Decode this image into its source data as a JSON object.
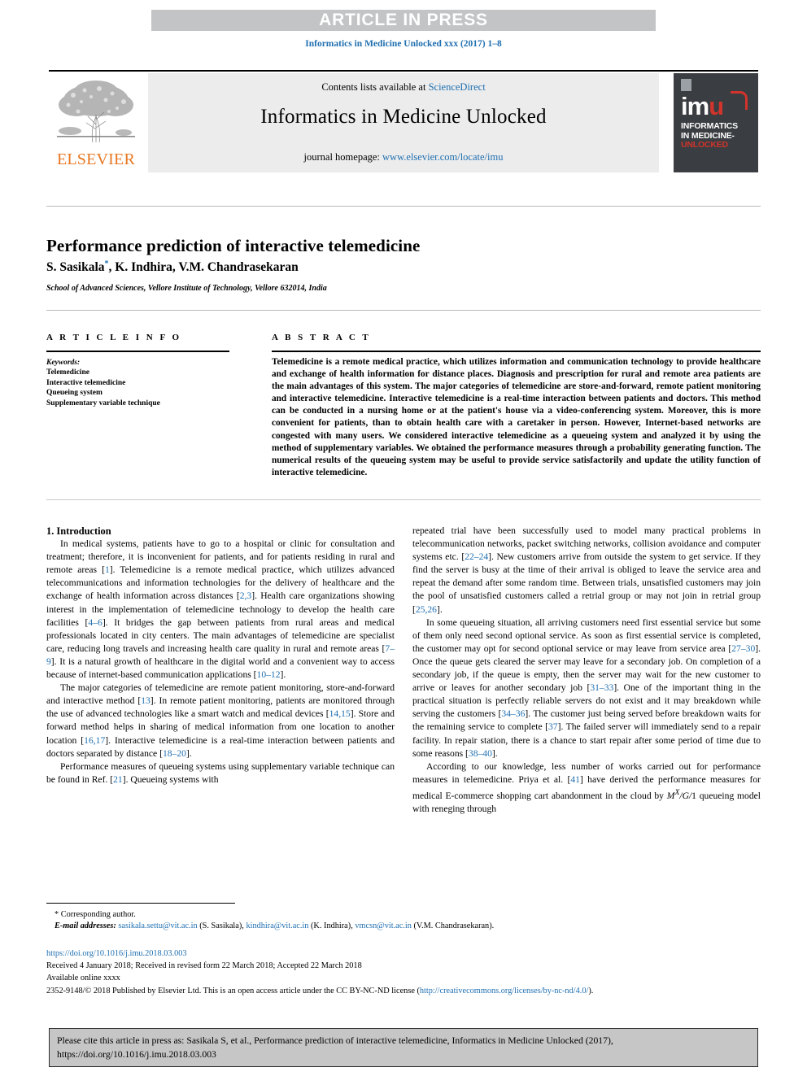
{
  "banner": {
    "press_label": "ARTICLE IN PRESS",
    "journal_ref": "Informatics in Medicine Unlocked xxx (2017) 1–8"
  },
  "masthead": {
    "contents_prefix": "Contents lists available at ",
    "sciencedirect": "ScienceDirect",
    "journal_name": "Informatics in Medicine Unlocked",
    "homepage_prefix": "journal homepage: ",
    "homepage_url": "www.elsevier.com/locate/imu",
    "elsevier_wordmark": "ELSEVIER",
    "imu_mark": "im",
    "imu_mark_u": "u",
    "imu_line1": "INFORMATICS",
    "imu_line2": "IN MEDICINE-",
    "imu_line3": "UNLOCKED",
    "accent_blue": "#1f6fb0",
    "elsevier_orange": "#e87722",
    "imu_red": "#d0342c"
  },
  "article": {
    "title": "Performance prediction of interactive telemedicine",
    "authors_pre": "S. Sasikala",
    "authors_star": "*",
    "authors_post": ", K. Indhira, V.M. Chandrasekaran",
    "affiliation": "School of Advanced Sciences, Vellore Institute of Technology, Vellore 632014, India"
  },
  "info": {
    "heading": "A R T I C L E  I N F O",
    "keywords_label": "Keywords:",
    "keywords": [
      "Telemedicine",
      "Interactive telemedicine",
      "Queueing system",
      "Supplementary variable technique"
    ]
  },
  "abstract": {
    "heading": "A B S T R A C T",
    "text": "Telemedicine is a remote medical practice, which utilizes information and communication technology to provide healthcare and exchange of health information for distance places. Diagnosis and prescription for rural and remote area patients are the main advantages of this system. The major categories of telemedicine are store-and-forward, remote patient monitoring and interactive telemedicine. Interactive telemedicine is a real-time interaction between patients and doctors. This method can be conducted in a nursing home or at the patient's house via a video-conferencing system. Moreover, this is more convenient for patients, than to obtain health care with a caretaker in person. However, Internet-based networks are congested with many users. We considered interactive telemedicine as a queueing system and analyzed it by using the method of supplementary variables. We obtained the performance measures through a probability generating function. The numerical results of the queueing system may be useful to provide service satisfactorily and update the utility function of interactive telemedicine."
  },
  "body": {
    "section_number_title": "1. Introduction",
    "left_paragraphs": [
      "In medical systems, patients have to go to a hospital or clinic for consultation and treatment; therefore, it is inconvenient for patients, and for patients residing in rural and remote areas [1]. Telemedicine is a remote medical practice, which utilizes advanced telecommunications and information technologies for the delivery of healthcare and the exchange of health information across distances [2,3]. Health care organizations showing interest in the implementation of telemedicine technology to develop the health care facilities [4–6]. It bridges the gap between patients from rural areas and medical professionals located in city centers. The main advantages of telemedicine are specialist care, reducing long travels and increasing health care quality in rural and remote areas [7–9]. It is a natural growth of healthcare in the digital world and a convenient way to access because of internet-based communication applications [10–12].",
      "The major categories of telemedicine are remote patient monitoring, store-and-forward and interactive method [13]. In remote patient monitoring, patients are monitored through the use of advanced technologies like a smart watch and medical devices [14,15]. Store and forward method helps in sharing of medical information from one location to another location [16,17]. Interactive telemedicine is a real-time interaction between patients and doctors separated by distance [18–20].",
      "Performance measures of queueing systems using supplementary variable technique can be found in Ref. [21]. Queueing systems with"
    ],
    "right_paragraphs": [
      "repeated trial have been successfully used to model many practical problems in telecommunication networks, packet switching networks, collision avoidance and computer systems etc. [22–24]. New customers arrive from outside the system to get service. If they find the server is busy at the time of their arrival is obliged to leave the service area and repeat the demand after some random time. Between trials, unsatisfied customers may join the pool of unsatisfied customers called a retrial group or may not join in retrial group [25,26].",
      "In some queueing situation, all arriving customers need first essential service but some of them only need second optional service. As soon as first essential service is completed, the customer may opt for second optional service or may leave from service area [27–30]. Once the queue gets cleared the server may leave for a secondary job. On completion of a secondary job, if the queue is empty, then the server may wait for the new customer to arrive or leaves for another secondary job [31–33]. One of the important thing in the practical situation is perfectly reliable servers do not exist and it may breakdown while serving the customers [34–36]. The customer just being served before breakdown waits for the remaining service to complete [37]. The failed server will immediately send to a repair facility. In repair station, there is a chance to start repair after some period of time due to some reasons [38–40].",
      "According to our knowledge, less number of works carried out for performance measures in telemedicine. Priya et al. [41] have derived the performance measures for medical E-commerce shopping cart abandonment in the cloud by M^X/G/1 queueing model with reneging through"
    ]
  },
  "footnote": {
    "corresponding_marker": "*",
    "corresponding_label": "Corresponding author.",
    "email_label": "E-mail addresses:",
    "emails": [
      {
        "address": "sasikala.settu@vit.ac.in",
        "owner": "(S. Sasikala)"
      },
      {
        "address": "kindhira@vit.ac.in",
        "owner": "(K. Indhira)"
      },
      {
        "address": "vmcsn@vit.ac.in",
        "owner": "(V.M. Chandrasekaran)"
      }
    ]
  },
  "publication": {
    "doi": "https://doi.org/10.1016/j.imu.2018.03.003",
    "dates": "Received 4 January 2018; Received in revised form 22 March 2018; Accepted 22 March 2018",
    "available": "Available online xxxx",
    "copyright_pre": "2352-9148/© 2018 Published by Elsevier Ltd. This is an open access article under the CC BY-NC-ND license (",
    "license_url": "http://creativecommons.org/licenses/by-nc-nd/4.0/",
    "copyright_post": ")."
  },
  "cite_box": {
    "line1": "Please cite this article in press as: Sasikala S, et al., Performance prediction of interactive telemedicine, Informatics in Medicine Unlocked (2017),",
    "line2": "https://doi.org/10.1016/j.imu.2018.03.003"
  }
}
